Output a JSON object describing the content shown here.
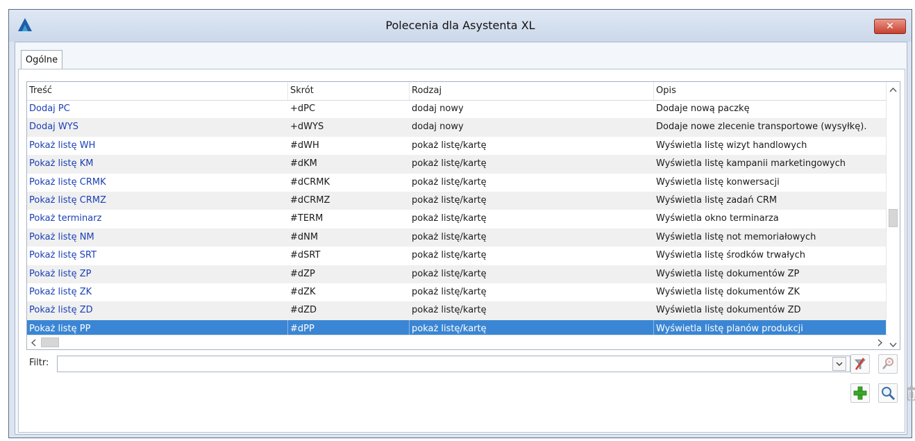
{
  "window": {
    "title": "Polecenia dla Asystenta XL",
    "close_label": "✕"
  },
  "tabs": [
    {
      "label": "Ogólne",
      "active": true
    }
  ],
  "grid": {
    "columns": [
      "Treść",
      "Skrót",
      "Rodzaj",
      "Opis"
    ],
    "rows": [
      {
        "tresc": "Dodaj PC",
        "skrot": "+dPC",
        "rodzaj": "dodaj nowy",
        "opis": "Dodaje nową paczkę"
      },
      {
        "tresc": "Dodaj WYS",
        "skrot": "+dWYS",
        "rodzaj": "dodaj nowy",
        "opis": "Dodaje nowe zlecenie transportowe (wysyłkę)."
      },
      {
        "tresc": "Pokaż listę WH",
        "skrot": "#dWH",
        "rodzaj": "pokaż listę/kartę",
        "opis": "Wyświetla listę wizyt handlowych"
      },
      {
        "tresc": "Pokaż listę KM",
        "skrot": "#dKM",
        "rodzaj": "pokaż listę/kartę",
        "opis": "Wyświetla listę kampanii marketingowych"
      },
      {
        "tresc": "Pokaż listę CRMK",
        "skrot": "#dCRMK",
        "rodzaj": "pokaż listę/kartę",
        "opis": "Wyświetla listę konwersacji"
      },
      {
        "tresc": "Pokaż listę CRMZ",
        "skrot": "#dCRMZ",
        "rodzaj": "pokaż listę/kartę",
        "opis": "Wyświetla listę zadań CRM"
      },
      {
        "tresc": "Pokaż terminarz",
        "skrot": "#TERM",
        "rodzaj": "pokaż listę/kartę",
        "opis": "Wyświetla okno terminarza"
      },
      {
        "tresc": "Pokaż listę NM",
        "skrot": "#dNM",
        "rodzaj": "pokaż listę/kartę",
        "opis": "Wyświetla listę not memoriałowych"
      },
      {
        "tresc": "Pokaż listę SRT",
        "skrot": "#dSRT",
        "rodzaj": "pokaż listę/kartę",
        "opis": "Wyświetla listę środków trwałych"
      },
      {
        "tresc": "Pokaż listę ZP",
        "skrot": "#dZP",
        "rodzaj": "pokaż listę/kartę",
        "opis": "Wyświetla listę dokumentów ZP"
      },
      {
        "tresc": "Pokaż listę ZK",
        "skrot": "#dZK",
        "rodzaj": "pokaż listę/kartę",
        "opis": "Wyświetla listę dokumentów ZK"
      },
      {
        "tresc": "Pokaż listę ZD",
        "skrot": "#dZD",
        "rodzaj": "pokaż listę/kartę",
        "opis": "Wyświetla listę dokumentów ZD"
      },
      {
        "tresc": "Pokaż listę PP",
        "skrot": "#dPP",
        "rodzaj": "pokaż listę/kartę",
        "opis": "Wyświetla listę planów produkcji",
        "selected": true
      }
    ]
  },
  "filter": {
    "label": "Filtr:",
    "value": ""
  },
  "icons": {
    "app": "app-logo-icon",
    "clear_filter": "clear-filter-icon",
    "filter_settings": "filter-settings-icon",
    "add": "add-icon",
    "search": "search-icon",
    "delete": "trash-icon"
  },
  "colors": {
    "link_text": "#1a3fb5",
    "selection": "#3a86d4",
    "add_green": "#3aa628",
    "clear_red": "#d63a2a"
  }
}
